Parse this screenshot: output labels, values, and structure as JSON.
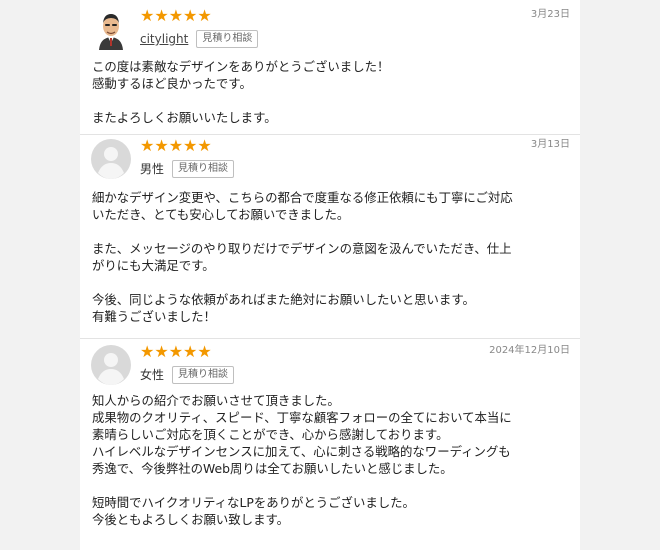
{
  "reviews": [
    {
      "rating_stars": "★★★★★",
      "rating": 5,
      "date": "3月23日",
      "user": "citylight",
      "tag": "見積り相談",
      "avatar": "man-photo-avatar",
      "body": "この度は素敵なデザインをありがとうございました！\n感動するほど良かったです。\n\nまたよろしくお願いいたします。"
    },
    {
      "rating_stars": "★★★★★",
      "rating": 5,
      "date": "3月13日",
      "user": "男性",
      "tag": "見積り相談",
      "avatar": "default-user-avatar",
      "body": "細かなデザイン変更や、こちらの都合で度重なる修正依頼にも丁寧にご対応\nいただき、とても安心してお願いできました。\n\nまた、メッセージのやり取りだけでデザインの意図を汲んでいただき、仕上\nがりにも大満足です。\n\n今後、同じような依頼があればまた絶対にお願いしたいと思います。\n有難うございました！"
    },
    {
      "rating_stars": "★★★★★",
      "rating": 5,
      "date": "2024年12月10日",
      "user": "女性",
      "tag": "見積り相談",
      "avatar": "default-user-avatar",
      "body": "知人からの紹介でお願いさせて頂きました。\n成果物のクオリティ、スピード、丁寧な顧客フォローの全てにおいて本当に\n素晴らしいご対応を頂くことができ、心から感謝しております。\nハイレベルなデザインセンスに加えて、心に刺さる戦略的なワーディングも\n秀逸で、今後弊社のWeb周りは全てお願いしたいと感じました。\n\n短時間でハイクオリティなLPをありがとうございました。\n今後ともよろしくお願い致します。"
    }
  ]
}
